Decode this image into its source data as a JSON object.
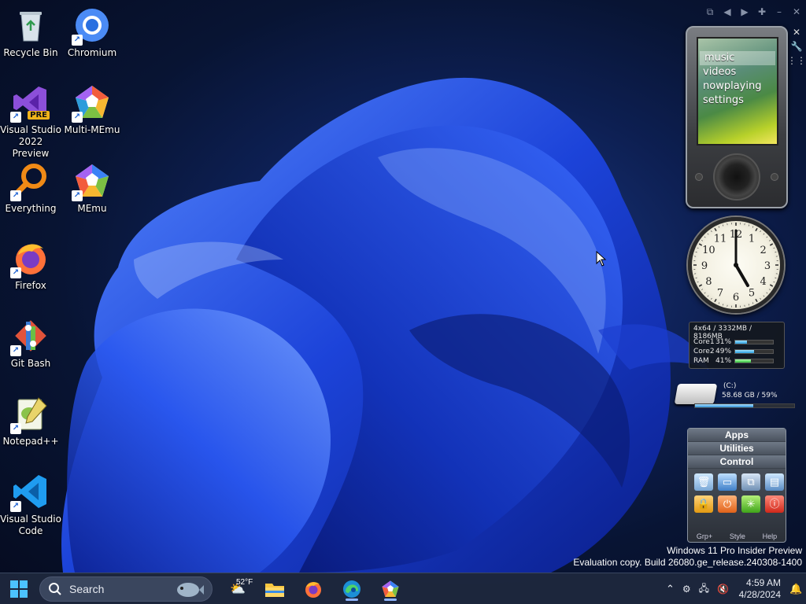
{
  "desktop": {
    "icons": [
      {
        "label": "Recycle Bin",
        "icon": "recycle-bin-icon"
      },
      {
        "label": "Chromium",
        "icon": "chromium-icon"
      },
      {
        "label": "Visual Studio 2022 Preview",
        "badge": "PRE",
        "icon": "visual-studio-preview-icon"
      },
      {
        "label": "Multi-MEmu",
        "icon": "multi-memu-icon"
      },
      {
        "label": "Everything",
        "icon": "everything-search-icon"
      },
      {
        "label": "MEmu",
        "icon": "memu-icon"
      },
      {
        "label": "Firefox",
        "icon": "firefox-icon"
      },
      {
        "label": "Git Bash",
        "icon": "git-bash-icon"
      },
      {
        "label": "Notepad++",
        "icon": "notepad-plus-plus-icon"
      },
      {
        "label": "Visual Studio Code",
        "icon": "vscode-icon"
      }
    ]
  },
  "gadgets": {
    "zune": {
      "menu": [
        "music",
        "videos",
        "nowplaying",
        "settings"
      ],
      "selected": "music"
    },
    "clock": {
      "hours": 5,
      "minutes": 0,
      "numerals": [
        "1",
        "2",
        "3",
        "4",
        "5",
        "6",
        "7",
        "8",
        "9",
        "10",
        "11",
        "12"
      ]
    },
    "cpu": {
      "header": "4x64 / 3332MB / 8186MB",
      "rows": [
        {
          "name": "Core1",
          "value": "31%",
          "percent": 31
        },
        {
          "name": "Core2",
          "value": "49%",
          "percent": 49
        },
        {
          "name": "RAM",
          "value": "41%",
          "percent": 41
        }
      ]
    },
    "drive": {
      "letter": "(C:)",
      "info": "58.68 GB / 59%",
      "percent": 59
    },
    "launcher": {
      "headers": [
        "Apps",
        "Utilities",
        "Control"
      ],
      "icons": [
        "recycle-icon",
        "drive-icon",
        "network-icon",
        "display-icon",
        "lock-icon",
        "power-icon",
        "restart-icon",
        "shutdown-icon"
      ],
      "footer": [
        "Grp+",
        "Style",
        "Help"
      ]
    }
  },
  "watermark": {
    "line1": "Windows 11 Pro Insider Preview",
    "line2": "Evaluation copy. Build 26080.ge_release.240308-1400"
  },
  "taskbar": {
    "search_label": "Search",
    "weather_temp": "52°F",
    "apps": [
      "file-explorer-icon",
      "firefox-icon",
      "edge-icon",
      "memu-icon"
    ],
    "time": "4:59 AM",
    "date": "4/28/2024"
  },
  "colors": {
    "accent": "#1a5fd1",
    "taskbar": "#1e283e"
  }
}
